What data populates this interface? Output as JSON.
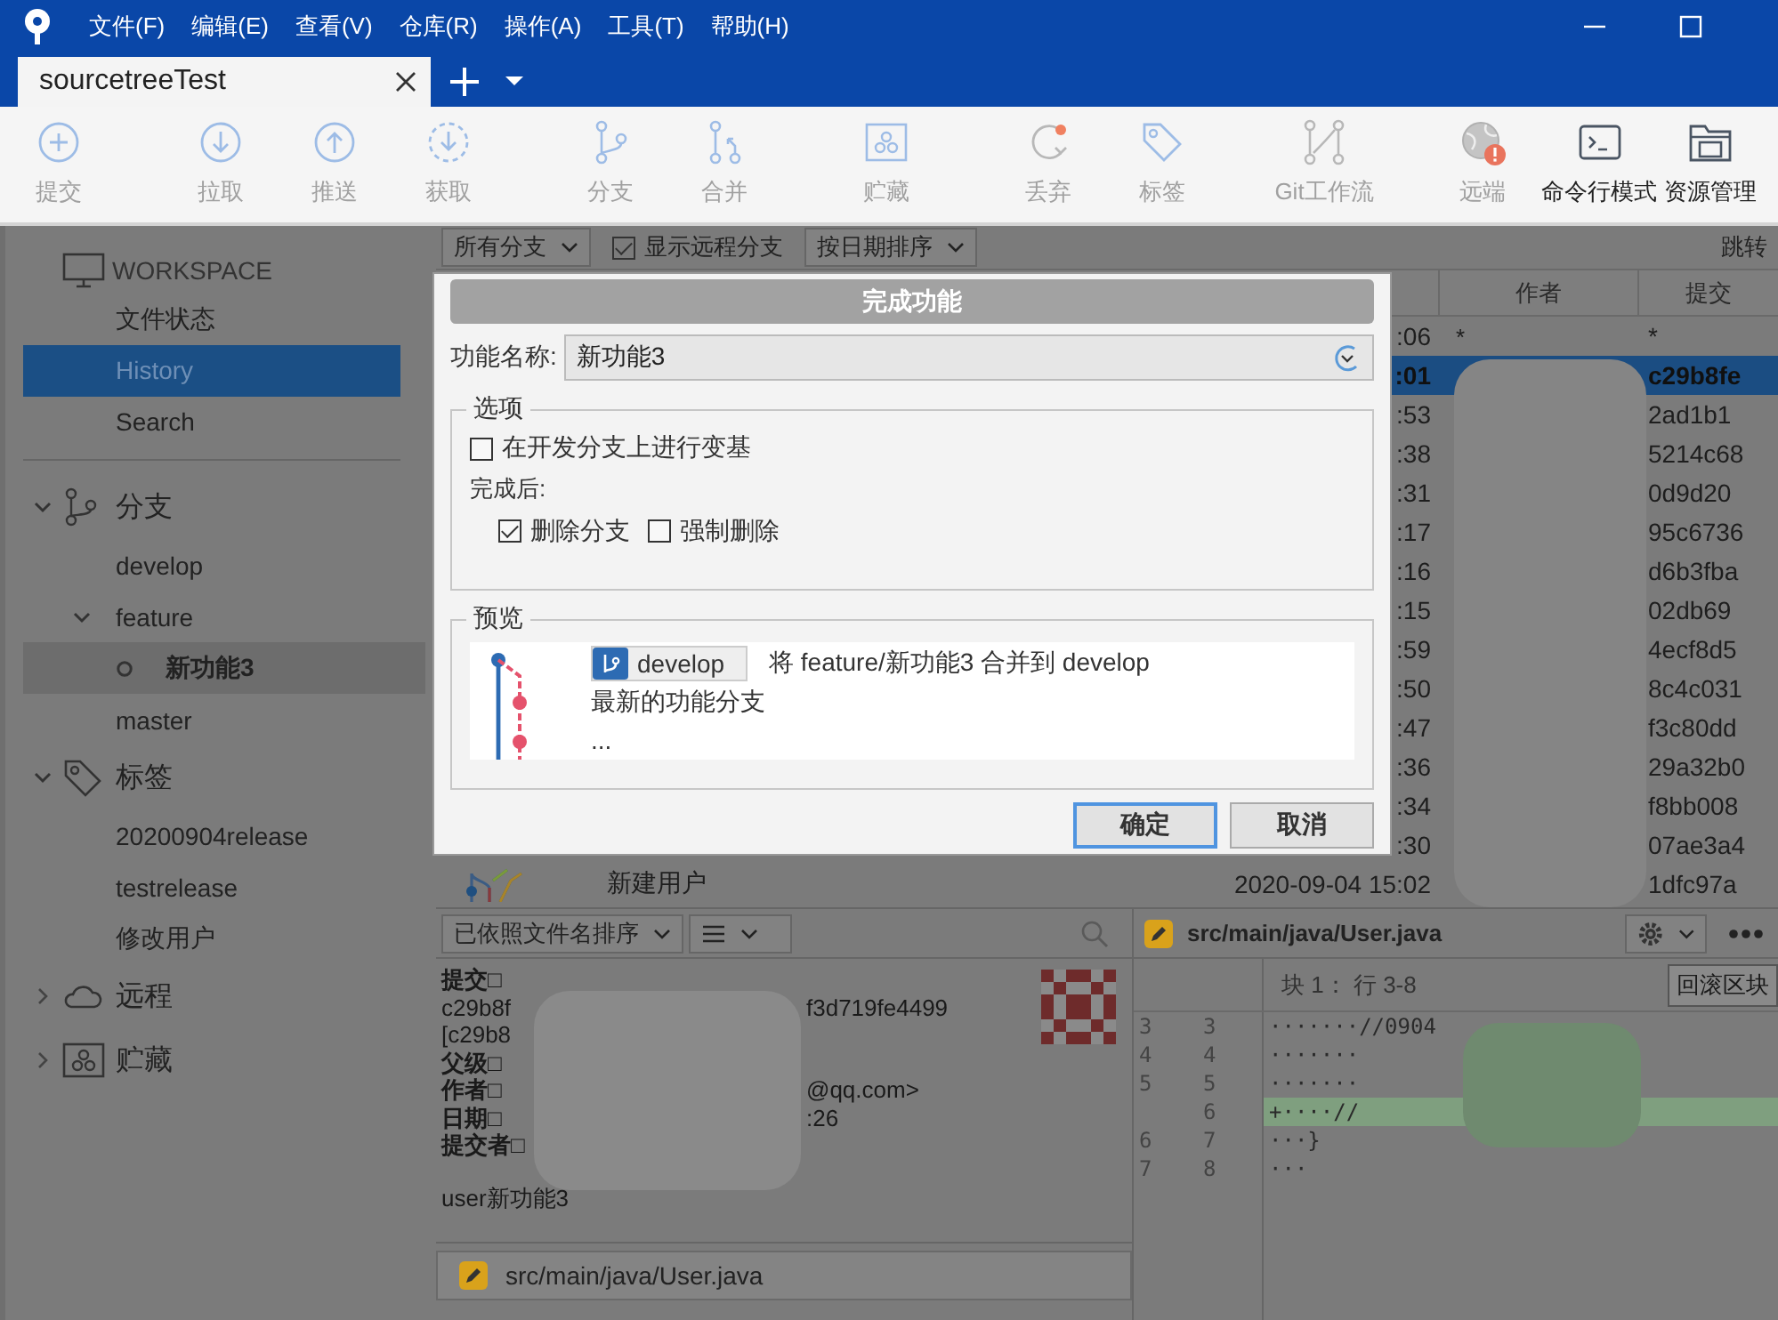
{
  "menu_bar": {
    "items": [
      "文件(F)",
      "编辑(E)",
      "查看(V)",
      "仓库(R)",
      "操作(A)",
      "工具(T)",
      "帮助(H)"
    ]
  },
  "tabs": [
    {
      "label": "sourcetreeTest",
      "selected": true
    }
  ],
  "toolbar": [
    {
      "items": [
        {
          "kind": "commit",
          "label": "提交",
          "disabled": true
        }
      ]
    },
    {
      "items": [
        {
          "kind": "pull",
          "label": "拉取",
          "disabled": true
        },
        {
          "kind": "push",
          "label": "推送",
          "disabled": true
        },
        {
          "kind": "fetch",
          "label": "获取",
          "disabled": true
        }
      ]
    },
    {
      "items": [
        {
          "kind": "branch",
          "label": "分支",
          "disabled": true
        },
        {
          "kind": "merge",
          "label": "合并",
          "disabled": true
        }
      ]
    },
    {
      "items": [
        {
          "kind": "stash",
          "label": "贮藏",
          "disabled": true
        }
      ]
    },
    {
      "items": [
        {
          "kind": "discard",
          "label": "丢弃",
          "disabled": true
        },
        {
          "kind": "tag",
          "label": "标签",
          "disabled": true
        }
      ]
    },
    {
      "items": [
        {
          "kind": "gitflow",
          "label": "Git工作流",
          "disabled": true
        }
      ]
    },
    {
      "items": [
        {
          "kind": "remote",
          "label": "远端",
          "disabled": true
        },
        {
          "kind": "terminal",
          "label": "命令行模式",
          "disabled": false
        },
        {
          "kind": "explorer",
          "label": "资源管理",
          "disabled": false
        }
      ]
    }
  ],
  "sidebar": {
    "workspace": {
      "title": "WORKSPACE",
      "items": [
        {
          "label": "文件状态",
          "selected": false
        },
        {
          "label": "History",
          "selected": true
        },
        {
          "label": "Search",
          "selected": false
        }
      ]
    },
    "sections": [
      {
        "kind": "branches",
        "label": "分支",
        "expanded": true,
        "children": [
          {
            "label": "develop",
            "selected": false,
            "current": false
          },
          {
            "label": "feature",
            "selected": false,
            "current": false,
            "expanded": true,
            "children": [
              {
                "label": "新功能3",
                "selected": true,
                "current": true
              }
            ]
          },
          {
            "label": "master",
            "selected": false,
            "current": false
          }
        ]
      },
      {
        "kind": "tags",
        "label": "标签",
        "expanded": true,
        "children": [
          {
            "label": "20200904release",
            "selected": false
          },
          {
            "label": "testrelease",
            "selected": false
          },
          {
            "label": "修改用户",
            "selected": false
          }
        ]
      },
      {
        "kind": "remotes",
        "label": "远程",
        "expanded": false
      },
      {
        "kind": "stashes",
        "label": "贮藏",
        "expanded": false
      }
    ]
  },
  "filter_bar": {
    "branch_filter": "所有分支",
    "show_remote": {
      "label": "显示远程分支",
      "checked": true
    },
    "sort": "按日期排序",
    "jump": "跳转"
  },
  "table": {
    "columns": [
      {
        "label": "作者"
      },
      {
        "label": "提交"
      }
    ],
    "rows": [
      {
        "date": ":06",
        "author": "*",
        "commit": "*",
        "selected": false
      },
      {
        "date": ":01",
        "commit": "c29b8fe",
        "selected": true
      },
      {
        "date": ":53",
        "commit": "2ad1b1",
        "selected": false
      },
      {
        "date": ":38",
        "commit": "5214c68",
        "selected": false
      },
      {
        "date": ":31",
        "commit": "0d9d20",
        "selected": false
      },
      {
        "date": ":17",
        "commit": "95c6736",
        "selected": false
      },
      {
        "date": ":16",
        "commit": "d6b3fba",
        "selected": false
      },
      {
        "date": ":15",
        "commit": "02db69",
        "selected": false
      },
      {
        "date": ":59",
        "commit": "4ecf8d5",
        "selected": false
      },
      {
        "date": ":50",
        "commit": "8c4c031",
        "selected": false
      },
      {
        "date": ":47",
        "commit": "f3c80dd",
        "selected": false
      },
      {
        "date": ":36",
        "commit": "29a32b0",
        "selected": false
      },
      {
        "date": ":34",
        "commit": "f8bb008",
        "selected": false
      },
      {
        "date": ":30",
        "commit": "07ae3a4",
        "selected": false
      },
      {
        "description": "新建用户",
        "date": "2020-09-04 15:02",
        "commit": "1dfc97a",
        "selected": false
      }
    ]
  },
  "dialog": {
    "title": "完成功能",
    "name_label": "功能名称:",
    "name_value": "新功能3",
    "options": {
      "legend": "选项",
      "rebase": {
        "label": "在开发分支上进行变基",
        "checked": false
      },
      "after_label": "完成后:",
      "after": [
        {
          "label": "删除分支",
          "checked": true
        },
        {
          "label": "强制删除",
          "checked": false
        }
      ]
    },
    "preview": {
      "legend": "预览",
      "branch": "develop",
      "message": "将 feature/新功能3 合并到 develop",
      "lines": [
        "最新的功能分支",
        "..."
      ]
    },
    "buttons": [
      {
        "label": "确定",
        "default": true
      },
      {
        "label": "取消",
        "default": false
      }
    ]
  },
  "file_list": {
    "sort": "已依照文件名排序",
    "files": [
      {
        "path": "src/main/java/User.java"
      }
    ]
  },
  "commit_details": {
    "lines": [
      {
        "label": "提交□"
      },
      {
        "text": "c29b8f",
        "tail": "f3d719fe4499"
      },
      {
        "text": "[c29b8"
      },
      {
        "label": "父级□"
      },
      {
        "label": "作者□",
        "tail": "@qq.com>"
      },
      {
        "label": "日期□",
        "tail": ":26"
      },
      {
        "label": "提交者□"
      }
    ],
    "message": "user新功能3"
  },
  "diff": {
    "path": "src/main/java/User.java",
    "hunk": "块 1： 行 3-8",
    "revert": "回滚区块",
    "lines": [
      {
        "kind": "context",
        "old": "3",
        "new": "3",
        "text": "·······//0904"
      },
      {
        "kind": "context",
        "old": "4",
        "new": "4",
        "text": "·······"
      },
      {
        "kind": "context",
        "old": "5",
        "new": "5",
        "text": "·······"
      },
      {
        "kind": "added",
        "new": "6",
        "text": "+····//"
      },
      {
        "kind": "context",
        "old": "6",
        "new": "7",
        "text": "···}"
      },
      {
        "kind": "context",
        "old": "7",
        "new": "8",
        "text": "···"
      }
    ]
  }
}
